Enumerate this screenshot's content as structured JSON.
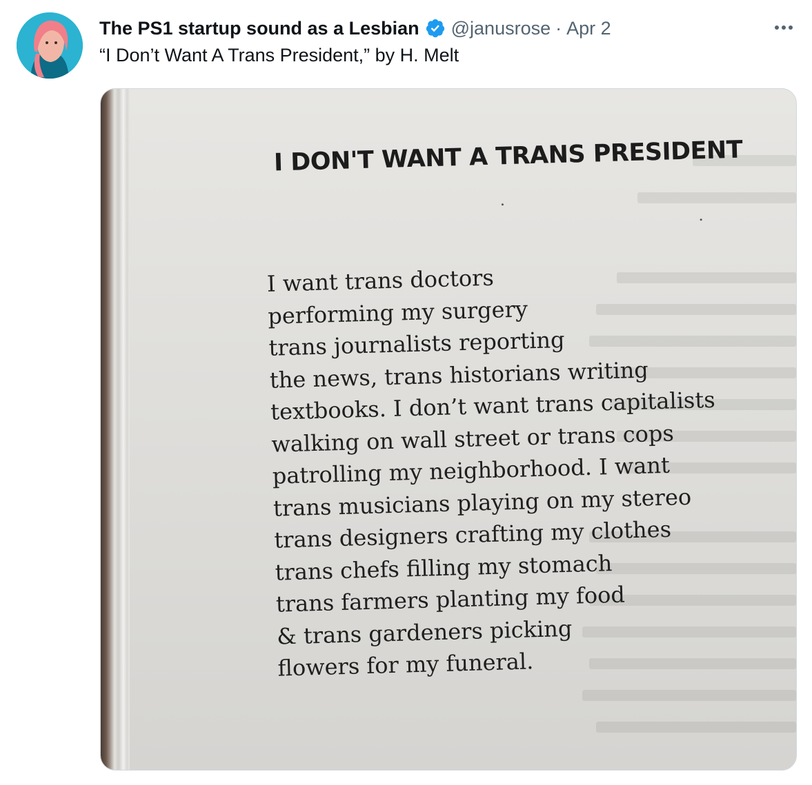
{
  "tweet": {
    "author": {
      "display_name": "The PS1 startup sound as a Lesbian",
      "handle": "@janusrose",
      "verified": true,
      "avatar": "avatar-photo"
    },
    "separator": "·",
    "date": "Apr 2",
    "more_icon": "more-horizontal-icon",
    "text": "“I Don’t Want A Trans President,” by H. Melt"
  },
  "media": {
    "poem_title": "I DON'T WANT A TRANS PRESIDENT",
    "poem_lines": [
      "I want trans doctors",
      "performing my surgery",
      "trans journalists reporting",
      "the news, trans historians writing",
      "textbooks. I don’t want trans capitalists",
      "walking on wall street or trans cops",
      "patrolling my neighborhood. I want",
      "trans musicians playing on my stereo",
      "trans designers crafting my clothes",
      "trans chefs filling my stomach",
      "trans farmers planting my food",
      "& trans gardeners picking",
      "flowers for my funeral."
    ]
  },
  "colors": {
    "text_primary": "#0f1419",
    "text_secondary": "#536471",
    "verified_badge": "#1d9bf0",
    "paper": "#e2e1de"
  }
}
